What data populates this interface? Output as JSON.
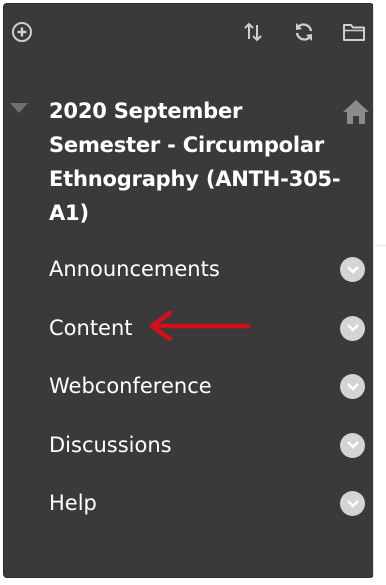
{
  "toolbar": {
    "add_icon": "plus-circle-icon",
    "sort_icon": "sort-arrows-icon",
    "refresh_icon": "refresh-icon",
    "folder_icon": "folder-icon"
  },
  "course": {
    "title": "2020 September Semester - Circumpolar Ethnography (ANTH-305-A1)",
    "toggle_icon": "caret-down-icon",
    "home_icon": "home-icon"
  },
  "menu": {
    "items": [
      {
        "label": "Announcements"
      },
      {
        "label": "Content",
        "highlighted": true
      },
      {
        "label": "Webconference"
      },
      {
        "label": "Discussions"
      },
      {
        "label": "Help"
      }
    ],
    "chevron_icon": "chevron-down-circle-icon"
  },
  "annotation": {
    "arrow_color": "#d0101a",
    "points_to": "Content"
  },
  "colors": {
    "panel_bg": "#3a3a3a",
    "text": "#ffffff",
    "icon": "#cfcfcf",
    "chevron_bg": "#d4d4d4"
  }
}
